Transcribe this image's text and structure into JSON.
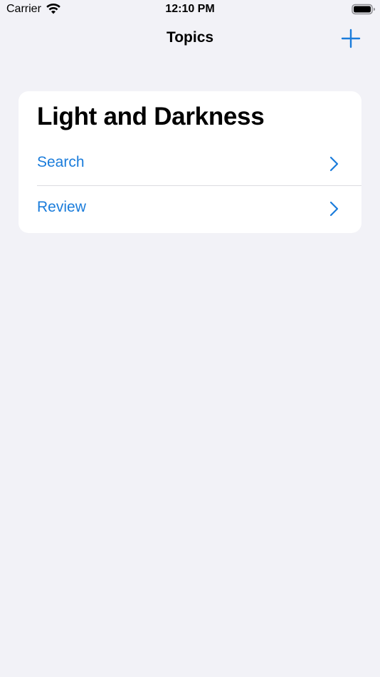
{
  "status_bar": {
    "carrier": "Carrier",
    "time": "12:10 PM",
    "icons": [
      "wifi-icon",
      "battery-icon"
    ]
  },
  "nav": {
    "title": "Topics",
    "add_icon": "plus-icon"
  },
  "card": {
    "title": "Light and Darkness",
    "rows": [
      {
        "label": "Search",
        "icon": "chevron-right-icon"
      },
      {
        "label": "Review",
        "icon": "chevron-right-icon"
      }
    ]
  },
  "colors": {
    "accent": "#1a7cdb",
    "background": "#f2f2f7",
    "card": "#ffffff",
    "separator": "#dcdce0"
  }
}
